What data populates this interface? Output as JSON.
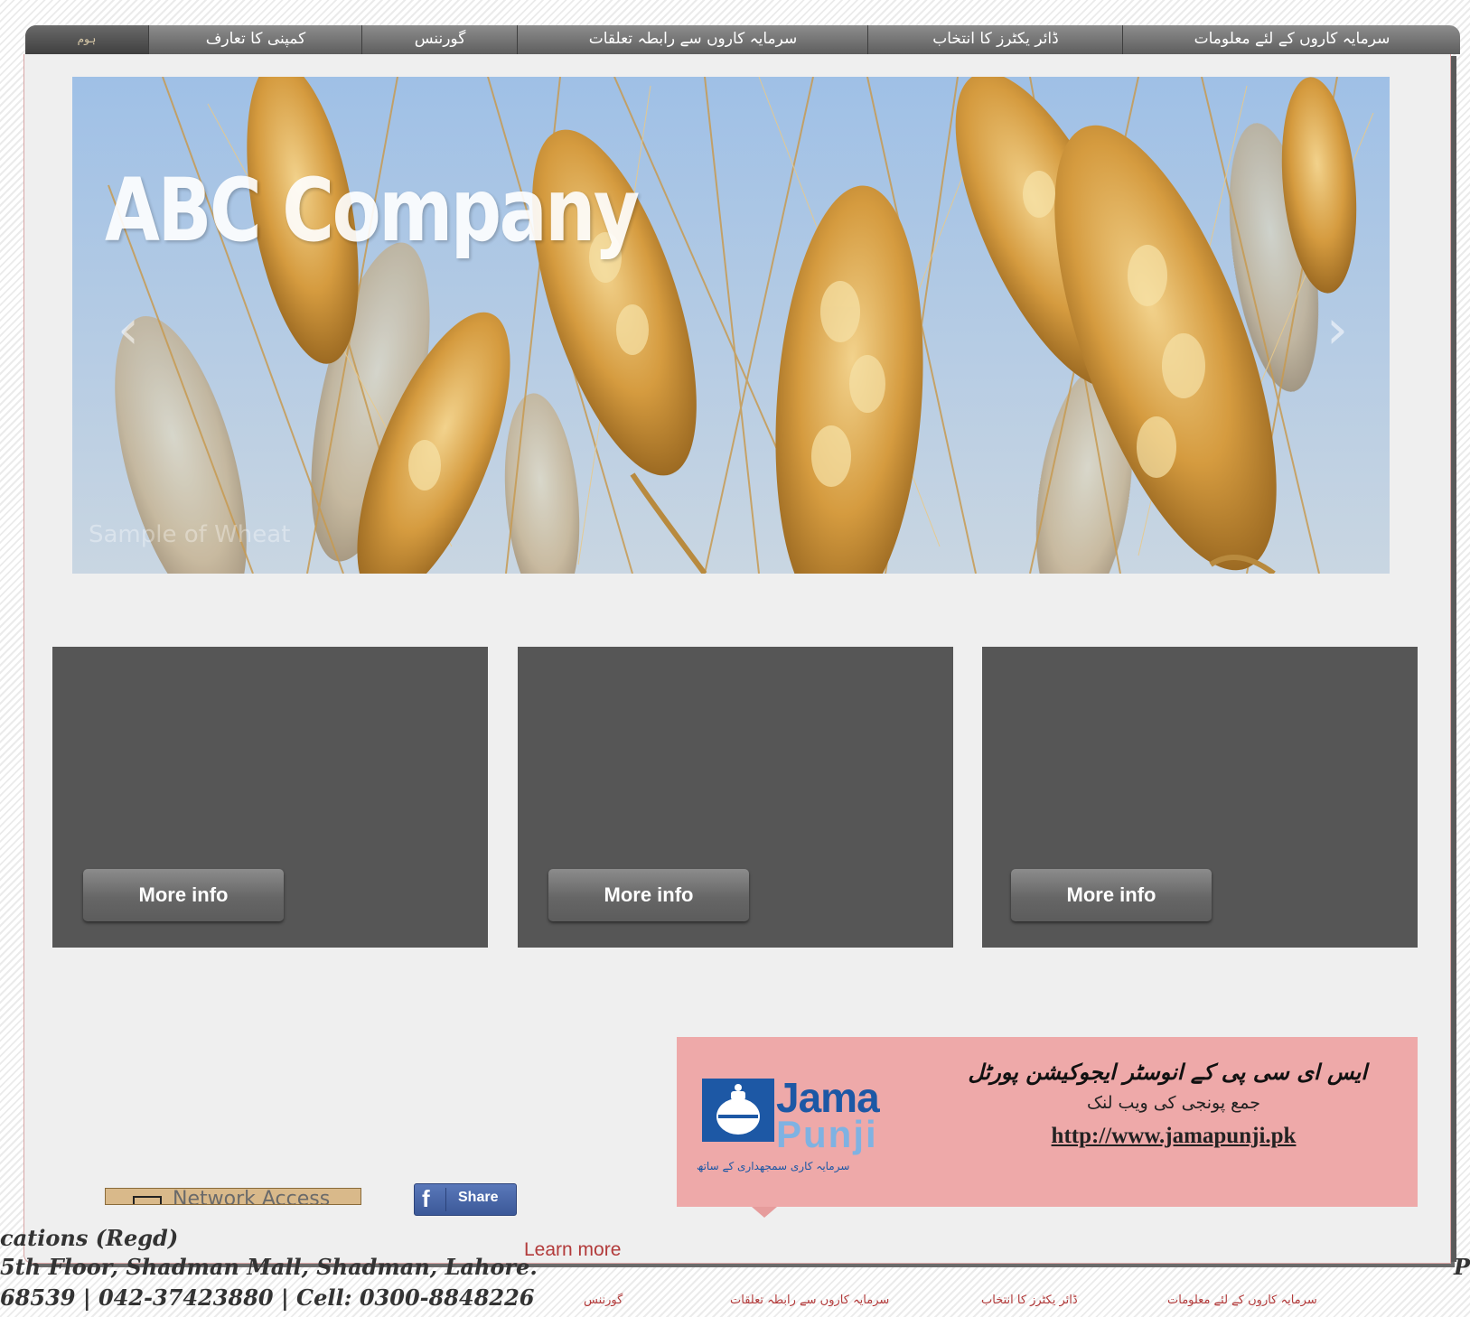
{
  "nav": {
    "items": [
      {
        "label": "سرمایہ کاروں کے لئے معلومات"
      },
      {
        "label": "ڈائر یکٹرز کا انتخاب"
      },
      {
        "label": "سرمایہ کاروں سے رابطہ تعلقات"
      },
      {
        "label": "گورننس"
      },
      {
        "label": "کمپنی کا تعارف"
      },
      {
        "label": "ہوم"
      }
    ]
  },
  "banner": {
    "title": "ABC Company",
    "caption": "Sample of Wheat",
    "prev_icon": "chevron-left-icon",
    "next_icon": "chevron-right-icon"
  },
  "boxes": [
    {
      "button": "More info"
    },
    {
      "button": "More info"
    },
    {
      "button": "More info"
    }
  ],
  "ad": {
    "logo_word_1": "Jama",
    "logo_word_2": "Punji",
    "logo_tagline": "سرمایہ کاری سمجھداری کے ساتھ",
    "heading": "ایس ای سی پی کے انوسٹر ایجوکیشن پورٹل",
    "subheading": "جمع پونجی کی ویب لنک",
    "link": "http://www.jamapunji.pk",
    "background": "#eea9a9",
    "brand_color": "#1d58a5"
  },
  "widgets": {
    "network_text": "Network Access",
    "share_label": "Share"
  },
  "footer": {
    "learn_more": "Learn more",
    "line1": "cations (Regd)",
    "line2": "5th Floor, Shadman Mall, Shadman, Lahore.",
    "line3": "68539 | 042-37423880 | Cell: 0300-8848226",
    "right_char": "P",
    "links": [
      {
        "label": "گورننس"
      },
      {
        "label": "سرمایہ کاروں سے رابطہ تعلقات"
      },
      {
        "label": "ڈائر یکٹرز کا انتخاب"
      },
      {
        "label": "سرمایہ کاروں کے لئے معلومات"
      }
    ]
  }
}
